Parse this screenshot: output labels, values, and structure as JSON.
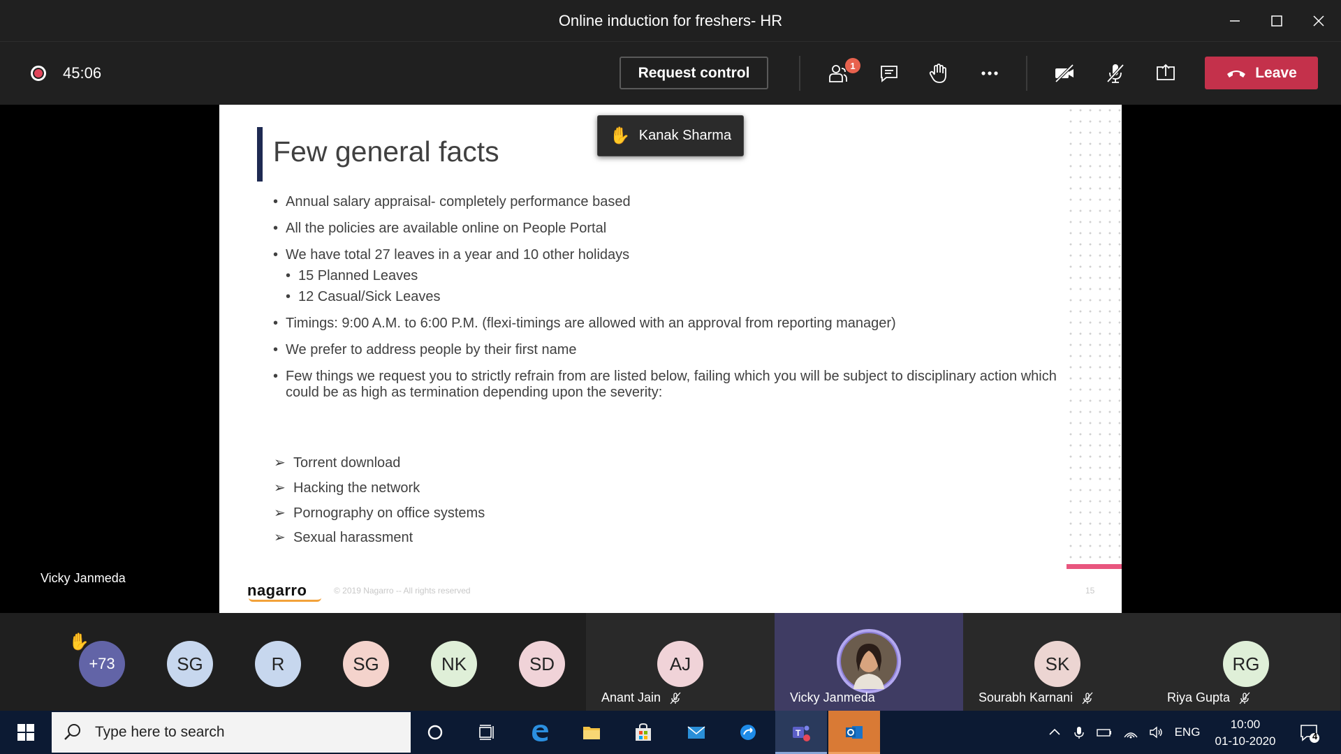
{
  "window": {
    "title": "Online induction for freshers- HR"
  },
  "toolbar": {
    "timer": "45:06",
    "request_control_label": "Request control",
    "participants_badge": "1",
    "leave_label": "Leave"
  },
  "stage": {
    "presenter_name": "Vicky Janmeda",
    "raised_hand_tooltip": "Kanak Sharma"
  },
  "slide": {
    "title": "Few general facts",
    "bullets": [
      "Annual salary appraisal- completely performance based",
      "All the policies are available online on People Portal",
      "We have total 27 leaves in a year and 10 other holidays",
      "15 Planned Leaves",
      "12 Casual/Sick Leaves",
      "Timings: 9:00 A.M.  to 6:00 P.M. (flexi-timings are allowed with an approval from reporting manager)",
      "We prefer to address people by their first name",
      "Few things we request you to strictly refrain from are listed below, failing which you will be subject to disciplinary action which could be as high as termination depending upon the severity:"
    ],
    "arrow_items": [
      "Torrent download",
      "Hacking the network",
      "Pornography on office systems",
      "Sexual harassment"
    ],
    "logo": "nagarro",
    "copyright": "© 2019 Nagarro -- All rights reserved",
    "page_number": "15"
  },
  "participants": {
    "overflow": "+73",
    "small_avatars": [
      {
        "initials": "SG",
        "color": "#c7d7ee"
      },
      {
        "initials": "R",
        "color": "#c7d7ee"
      },
      {
        "initials": "SG",
        "color": "#f4d3cc"
      },
      {
        "initials": "NK",
        "color": "#dfefd8"
      },
      {
        "initials": "SD",
        "color": "#f0d3d8"
      }
    ],
    "tiles": [
      {
        "initials": "AJ",
        "name": "Anant Jain",
        "color": "#f0d3d8"
      },
      {
        "initials": "",
        "name": "Vicky Janmeda",
        "color": "#8a7cd3"
      },
      {
        "initials": "SK",
        "name": "Sourabh Karnani",
        "color": "#ecd5d2"
      },
      {
        "initials": "RG",
        "name": "Riya Gupta",
        "color": "#dfefd8"
      }
    ]
  },
  "taskbar": {
    "search_placeholder": "Type here to search",
    "language": "ENG",
    "time": "10:00",
    "date": "01-10-2020",
    "notification_count": "4"
  }
}
